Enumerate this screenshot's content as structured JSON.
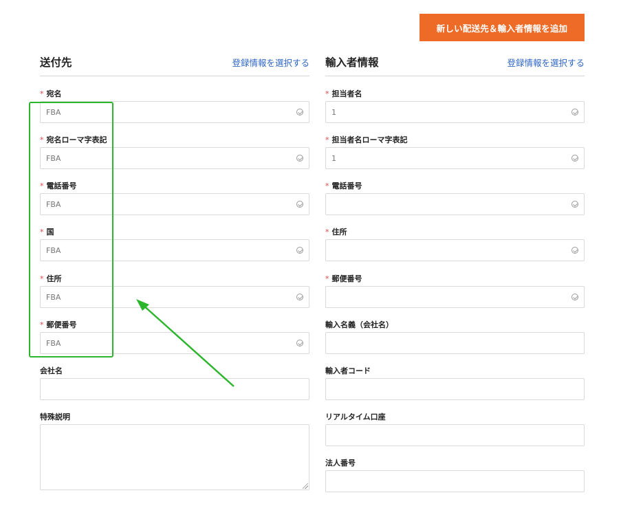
{
  "top_button": {
    "label": "新しい配送先＆輸入者情報を追加"
  },
  "left_section": {
    "title": "送付先",
    "link": "登録情報を選択する",
    "fields": [
      {
        "label": "宛名",
        "required": true,
        "value": "FBA",
        "verified": true
      },
      {
        "label": "宛名ローマ字表記",
        "required": true,
        "value": "FBA",
        "verified": true
      },
      {
        "label": "電話番号",
        "required": true,
        "value": "FBA",
        "verified": true
      },
      {
        "label": "国",
        "required": true,
        "value": "FBA",
        "verified": true
      },
      {
        "label": "住所",
        "required": true,
        "value": "FBA",
        "verified": true
      },
      {
        "label": "郵便番号",
        "required": true,
        "value": "FBA",
        "verified": true
      },
      {
        "label": "会社名",
        "required": false,
        "value": "",
        "verified": false
      },
      {
        "label": "特殊説明",
        "required": false,
        "value": "",
        "verified": false,
        "multiline": true
      }
    ]
  },
  "right_section": {
    "title": "輸入者情報",
    "link": "登録情報を選択する",
    "fields": [
      {
        "label": "担当者名",
        "required": true,
        "value": "1",
        "verified": true
      },
      {
        "label": "担当者名ローマ字表記",
        "required": true,
        "value": "1",
        "verified": true
      },
      {
        "label": "電話番号",
        "required": true,
        "value": "",
        "verified": true
      },
      {
        "label": "住所",
        "required": true,
        "value": "",
        "verified": true
      },
      {
        "label": "郵便番号",
        "required": true,
        "value": "",
        "verified": true
      },
      {
        "label": "輸入名義（会社名）",
        "required": false,
        "value": "",
        "verified": false
      },
      {
        "label": "輸入者コード",
        "required": false,
        "value": "",
        "verified": false
      },
      {
        "label": "リアルタイム口座",
        "required": false,
        "value": "",
        "verified": false
      },
      {
        "label": "法人番号",
        "required": false,
        "value": "",
        "verified": false
      }
    ]
  },
  "required_marker": "*",
  "colors": {
    "accent_button": "#ed6b27",
    "link": "#2f66c4",
    "required": "#e04646",
    "annotation": "#2db52d"
  },
  "icons": {
    "verified": "check-circle-icon"
  }
}
